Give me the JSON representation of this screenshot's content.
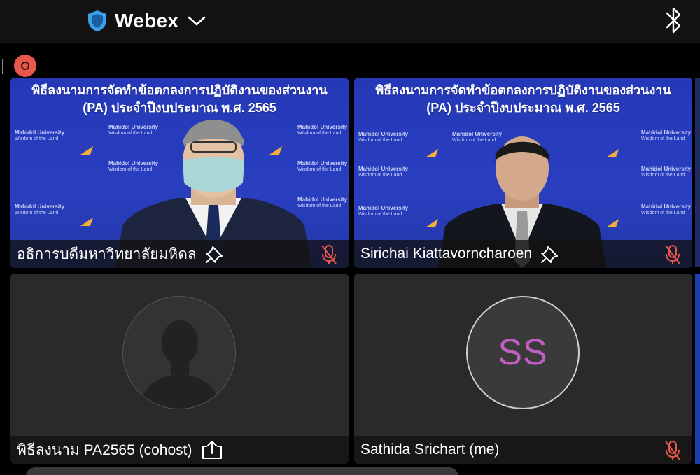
{
  "app": {
    "title": "Webex",
    "icons": [
      "shield-icon",
      "chevron-down-icon",
      "bluetooth-icon"
    ]
  },
  "recording": {
    "indicator": "recording-indicator"
  },
  "banner": {
    "line1": "พิธีลงนามการจัดทำข้อตกลงการปฏิบัติงานของส่วนงาน",
    "line2": "(PA) ประจำปีงบประมาณ พ.ศ. 2565"
  },
  "participants": [
    {
      "name": "อธิการบดีมหาวิทยาลัยมหิดล",
      "muted": true,
      "video": true,
      "icons": [
        "pin-icon",
        "mic-off-icon"
      ]
    },
    {
      "name": "Sirichai Kiattavorncharoen",
      "muted": true,
      "video": true,
      "icons": [
        "pin-icon",
        "mic-off-icon"
      ]
    },
    {
      "name": "พิธีลงนาม PA2565 (cohost)",
      "muted": false,
      "video": false,
      "icons": [
        "share-screen-icon",
        "default-avatar-icon"
      ]
    },
    {
      "name": "Sathida Srichart (me)",
      "initials": "SS",
      "muted": true,
      "video": false,
      "icons": [
        "mic-off-icon"
      ]
    }
  ],
  "colors": {
    "background": "#000000",
    "topbar": "#121212",
    "tile": "#2a2a2a",
    "record": "#e8584a",
    "muted_icon": "#e8584a",
    "shield": "#3aa0e8",
    "initials": "#c05fc4",
    "backdrop_blue": "#2a3fbf"
  }
}
